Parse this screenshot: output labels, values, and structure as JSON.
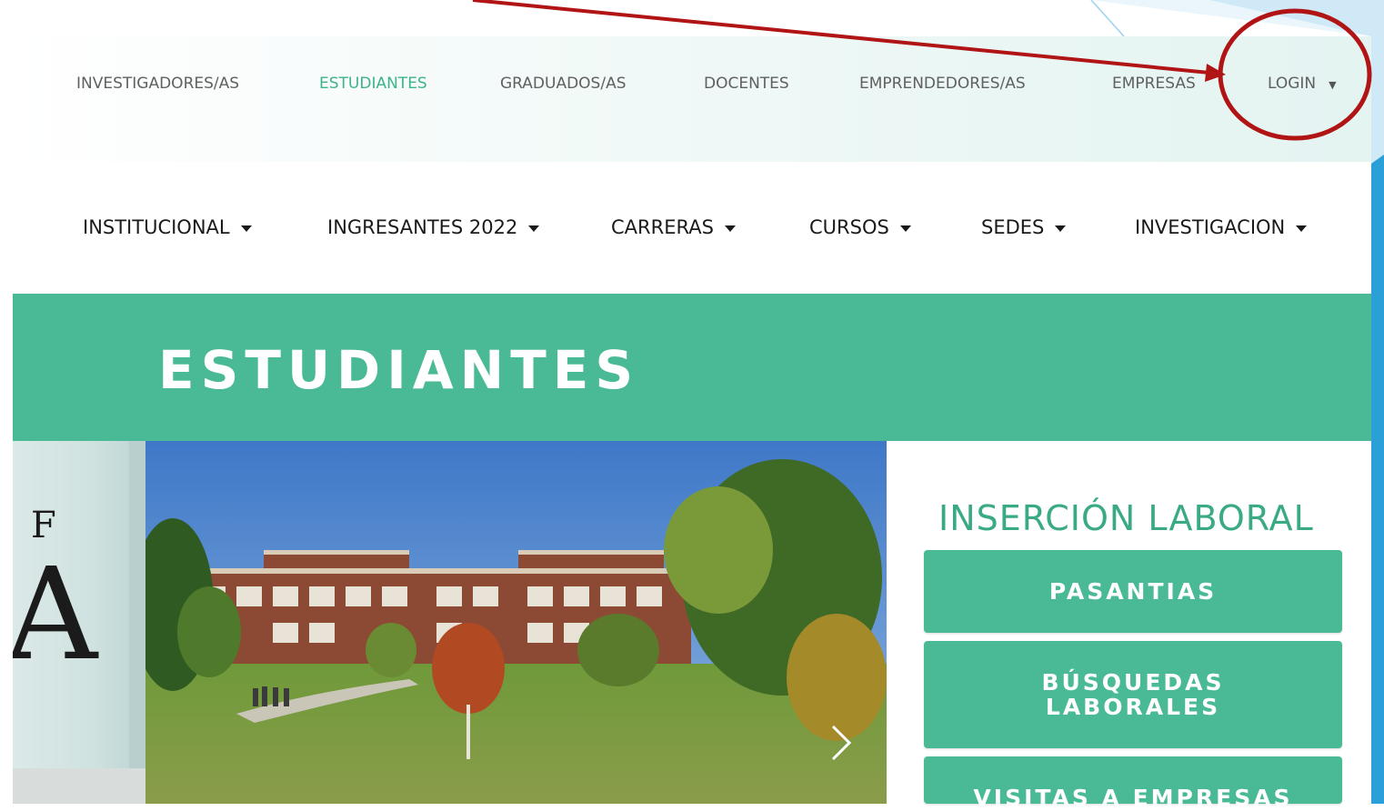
{
  "top_links": [
    {
      "label": "INVESTIGADORES/AS",
      "active": false
    },
    {
      "label": "ESTUDIANTES",
      "active": true
    },
    {
      "label": "GRADUADOS/AS",
      "active": false
    },
    {
      "label": "DOCENTES",
      "active": false
    },
    {
      "label": "EMPRENDEDORES/AS",
      "active": false
    },
    {
      "label": "EMPRESAS",
      "active": false
    },
    {
      "label": "LOGIN",
      "active": false
    }
  ],
  "main_nav": [
    {
      "label": "INSTITUCIONAL"
    },
    {
      "label": "INGRESANTES 2022"
    },
    {
      "label": "CARRERAS"
    },
    {
      "label": "CURSOS"
    },
    {
      "label": "SEDES"
    },
    {
      "label": "INVESTIGACION"
    }
  ],
  "banner": {
    "title": "ESTUDIANTES"
  },
  "sign": {
    "letter_top": "F",
    "letter_big": "A"
  },
  "panel": {
    "title": "INSERCIÓN LABORAL",
    "buttons": [
      {
        "label": "PASANTIAS"
      },
      {
        "label": "BÚSQUEDAS\nLABORALES"
      },
      {
        "label": "VISITAS A EMPRESAS"
      }
    ]
  },
  "colors": {
    "accent": "#4aba96",
    "active_link": "#3db38a",
    "annotation": "#b01414"
  }
}
